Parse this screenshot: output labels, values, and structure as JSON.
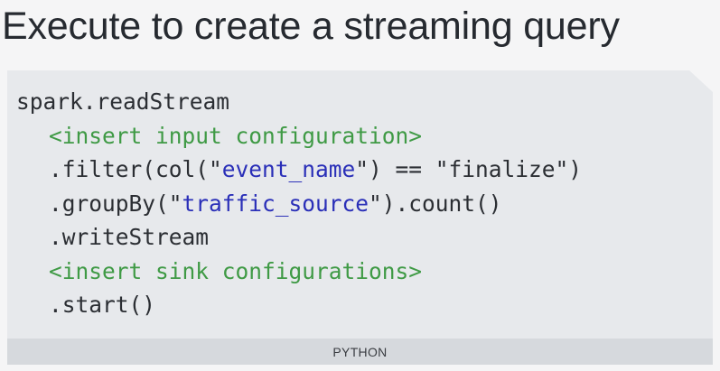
{
  "slide": {
    "title": "Execute to create a streaming query"
  },
  "code": {
    "language_label": "PYTHON",
    "lines": [
      {
        "segments": [
          "spark.readStream"
        ]
      },
      {
        "segments": [
          "<insert input configuration>"
        ]
      },
      {
        "segments": [
          ".filter(col(\"",
          "event_name",
          "\") == \"finalize\")"
        ]
      },
      {
        "segments": [
          ".groupBy(\"",
          "traffic_source",
          "\").count()"
        ]
      },
      {
        "segments": [
          ".writeStream"
        ]
      },
      {
        "segments": [
          "<insert sink configurations>"
        ]
      },
      {
        "segments": [
          ".start()"
        ]
      }
    ]
  },
  "colors": {
    "background": "#f5f5f6",
    "code_background": "#e7e9ec",
    "language_bar": "#d6d9dd",
    "code_text": "#2b2e33",
    "placeholder": "#3f9a45",
    "string_highlight": "#2a2fb8"
  }
}
